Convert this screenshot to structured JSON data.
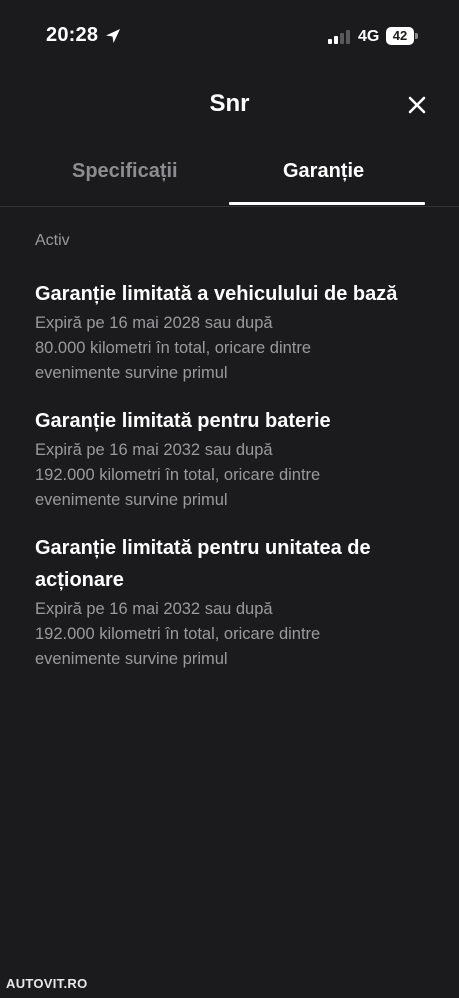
{
  "status_bar": {
    "time": "20:28",
    "network": "4G",
    "battery": "42"
  },
  "header": {
    "title": "Snr",
    "close_icon": "close-icon"
  },
  "tabs": [
    {
      "label": "Specificații",
      "active": false
    },
    {
      "label": "Garanție",
      "active": true
    }
  ],
  "section": {
    "label": "Activ"
  },
  "warranties": [
    {
      "title": "Garanție limitată a vehiculului de bază",
      "detail_lines": [
        "Expiră pe 16 mai 2028 sau după",
        "80.000 kilometri în total, oricare dintre",
        "evenimente survine primul"
      ]
    },
    {
      "title": "Garanție limitată pentru baterie",
      "detail_lines": [
        "Expiră pe 16 mai 2032 sau după",
        "192.000 kilometri în total, oricare dintre",
        "evenimente survine primul"
      ]
    },
    {
      "title_lines": [
        "Garanție limitată pentru unitatea de",
        "acționare"
      ],
      "detail_lines": [
        "Expiră pe 16 mai 2032 sau după",
        "192.000 kilometri în total, oricare dintre",
        "evenimente survine primul"
      ]
    }
  ],
  "watermark": "AUTOVIT.RO",
  "colors": {
    "background": "#1b1b1d",
    "primary_text": "#ffffff",
    "secondary_text": "#9a9a9d",
    "inactive_tab": "#8d8d90"
  }
}
